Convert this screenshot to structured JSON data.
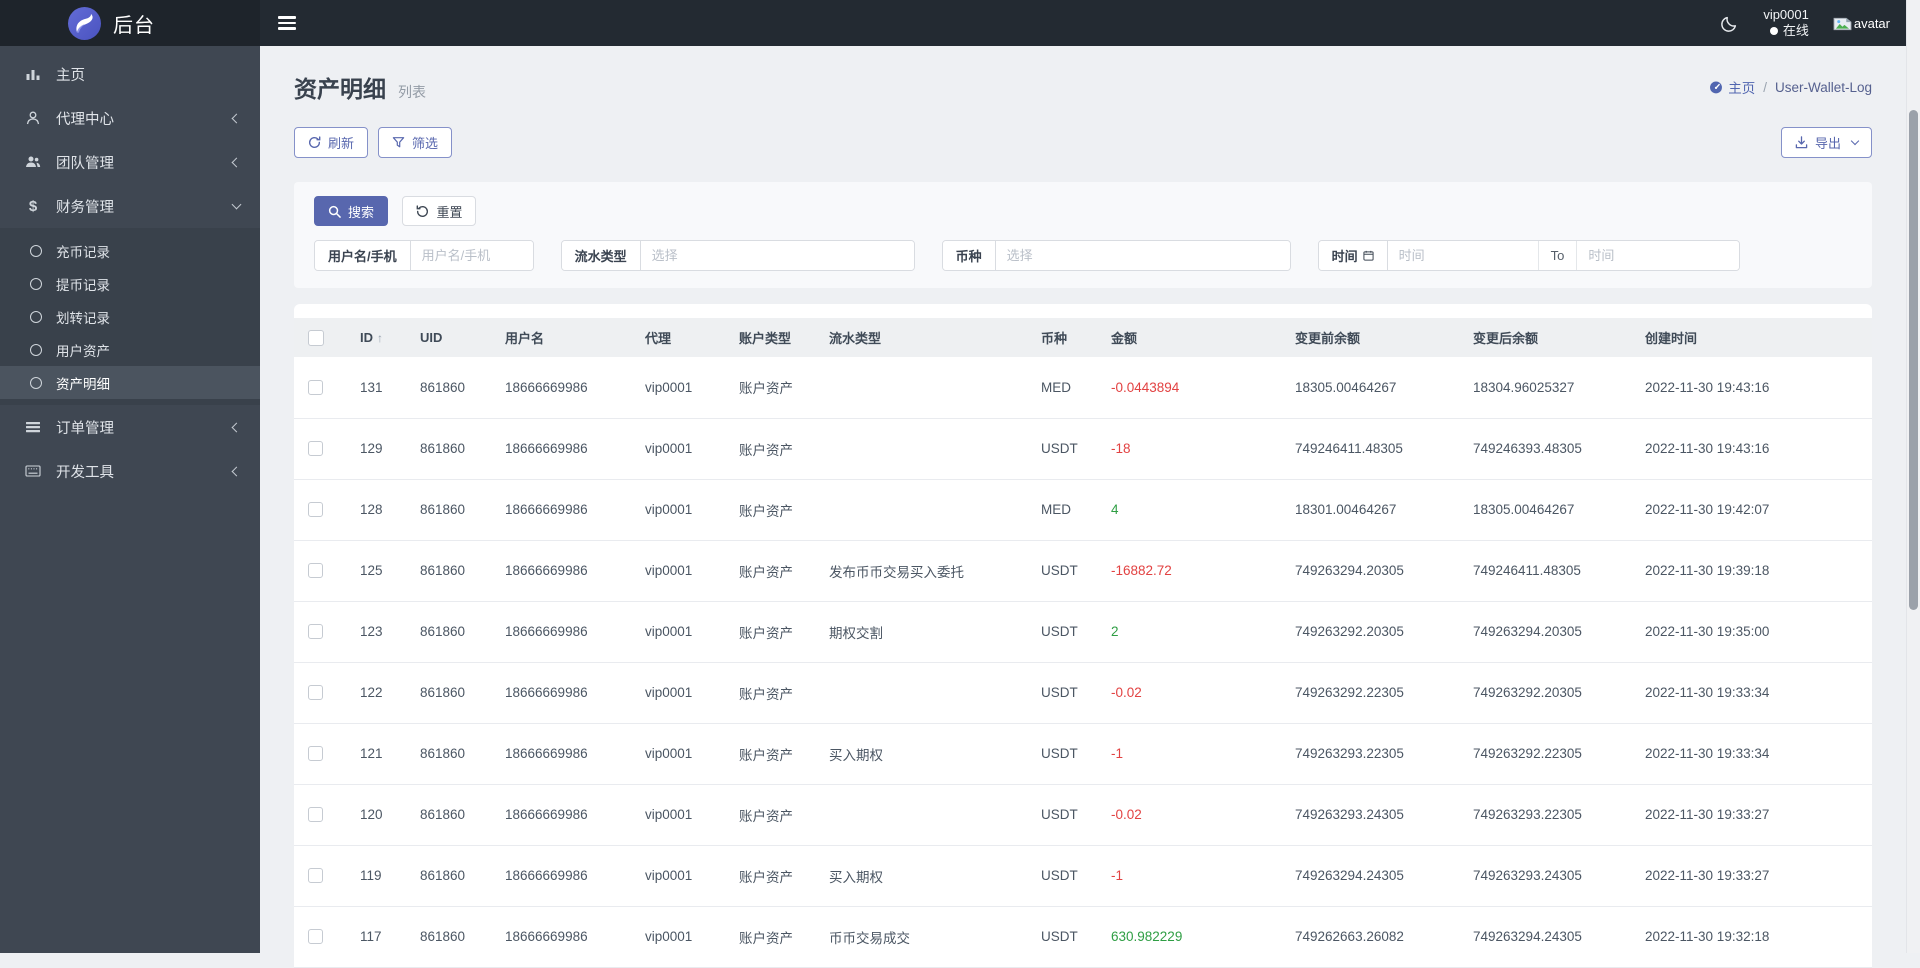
{
  "topbar": {
    "brand": "后台",
    "user": {
      "name": "vip0001",
      "status": "在线"
    },
    "avatar_alt": "avatar"
  },
  "sidebar": {
    "items": [
      {
        "label": "主页",
        "icon": "chart-bar-icon"
      },
      {
        "label": "代理中心",
        "icon": "agent-user-icon",
        "chevron": "left"
      },
      {
        "label": "团队管理",
        "icon": "team-users-icon",
        "chevron": "left"
      },
      {
        "label": "财务管理",
        "icon": "dollar-icon",
        "chevron": "down",
        "expanded": true,
        "children": [
          {
            "label": "充币记录"
          },
          {
            "label": "提币记录"
          },
          {
            "label": "划转记录"
          },
          {
            "label": "用户资产"
          },
          {
            "label": "资产明细",
            "active": true
          }
        ]
      },
      {
        "label": "订单管理",
        "icon": "list-icon",
        "chevron": "left"
      },
      {
        "label": "开发工具",
        "icon": "keyboard-icon",
        "chevron": "left"
      }
    ]
  },
  "page": {
    "title": "资产明细",
    "subtitle": "列表",
    "breadcrumb": {
      "home": "主页",
      "separator": "/",
      "current": "User-Wallet-Log"
    }
  },
  "toolbar": {
    "refresh_label": "刷新",
    "filter_label": "筛选",
    "export_label": "导出"
  },
  "filter_panel": {
    "search_label": "搜索",
    "reset_label": "重置",
    "fields": [
      {
        "name": "username-phone",
        "label": "用户名/手机",
        "placeholder": "用户名/手机",
        "type": "input",
        "input_width": 122
      },
      {
        "name": "flow-type",
        "label": "流水类型",
        "placeholder": "选择",
        "type": "select",
        "input_width": 273
      },
      {
        "name": "coin",
        "label": "币种",
        "placeholder": "选择",
        "type": "select",
        "input_width": 294
      },
      {
        "name": "time-range",
        "label": "时间",
        "type": "date-range",
        "placeholder": "时间",
        "to_label": "To",
        "placeholder2": "时间",
        "input_width": 150,
        "input_width2": 162
      }
    ]
  },
  "table": {
    "columns": [
      "ID",
      "UID",
      "用户名",
      "代理",
      "账户类型",
      "流水类型",
      "币种",
      "金额",
      "变更前余额",
      "变更后余额",
      "创建时间"
    ],
    "sort_column": "ID",
    "rows": [
      {
        "id": "131",
        "uid": "861860",
        "username": "18666669986",
        "agent": "vip0001",
        "account_type": "账户资产",
        "flow_type": "",
        "coin": "MED",
        "amount": "-0.0443894",
        "balance_before": "18305.00464267",
        "balance_after": "18304.96025327",
        "created_at": "2022-11-30 19:43:16"
      },
      {
        "id": "129",
        "uid": "861860",
        "username": "18666669986",
        "agent": "vip0001",
        "account_type": "账户资产",
        "flow_type": "",
        "coin": "USDT",
        "amount": "-18",
        "balance_before": "749246411.48305",
        "balance_after": "749246393.48305",
        "created_at": "2022-11-30 19:43:16"
      },
      {
        "id": "128",
        "uid": "861860",
        "username": "18666669986",
        "agent": "vip0001",
        "account_type": "账户资产",
        "flow_type": "",
        "coin": "MED",
        "amount": "4",
        "balance_before": "18301.00464267",
        "balance_after": "18305.00464267",
        "created_at": "2022-11-30 19:42:07"
      },
      {
        "id": "125",
        "uid": "861860",
        "username": "18666669986",
        "agent": "vip0001",
        "account_type": "账户资产",
        "flow_type": "发布币币交易买入委托",
        "coin": "USDT",
        "amount": "-16882.72",
        "balance_before": "749263294.20305",
        "balance_after": "749246411.48305",
        "created_at": "2022-11-30 19:39:18"
      },
      {
        "id": "123",
        "uid": "861860",
        "username": "18666669986",
        "agent": "vip0001",
        "account_type": "账户资产",
        "flow_type": "期权交割",
        "coin": "USDT",
        "amount": "2",
        "balance_before": "749263292.20305",
        "balance_after": "749263294.20305",
        "created_at": "2022-11-30 19:35:00"
      },
      {
        "id": "122",
        "uid": "861860",
        "username": "18666669986",
        "agent": "vip0001",
        "account_type": "账户资产",
        "flow_type": "",
        "coin": "USDT",
        "amount": "-0.02",
        "balance_before": "749263292.22305",
        "balance_after": "749263292.20305",
        "created_at": "2022-11-30 19:33:34"
      },
      {
        "id": "121",
        "uid": "861860",
        "username": "18666669986",
        "agent": "vip0001",
        "account_type": "账户资产",
        "flow_type": "买入期权",
        "coin": "USDT",
        "amount": "-1",
        "balance_before": "749263293.22305",
        "balance_after": "749263292.22305",
        "created_at": "2022-11-30 19:33:34"
      },
      {
        "id": "120",
        "uid": "861860",
        "username": "18666669986",
        "agent": "vip0001",
        "account_type": "账户资产",
        "flow_type": "",
        "coin": "USDT",
        "amount": "-0.02",
        "balance_before": "749263293.24305",
        "balance_after": "749263293.22305",
        "created_at": "2022-11-30 19:33:27"
      },
      {
        "id": "119",
        "uid": "861860",
        "username": "18666669986",
        "agent": "vip0001",
        "account_type": "账户资产",
        "flow_type": "买入期权",
        "coin": "USDT",
        "amount": "-1",
        "balance_before": "749263294.24305",
        "balance_after": "749263293.24305",
        "created_at": "2022-11-30 19:33:27"
      },
      {
        "id": "117",
        "uid": "861860",
        "username": "18666669986",
        "agent": "vip0001",
        "account_type": "账户资产",
        "flow_type": "币币交易成交",
        "coin": "USDT",
        "amount": "630.982229",
        "balance_before": "749262663.26082",
        "balance_after": "749263294.24305",
        "created_at": "2022-11-30 19:32:18"
      }
    ]
  },
  "colors": {
    "accent": "#5867ae",
    "amount_negative": "#e24242",
    "amount_positive": "#2f9e44",
    "sidebar_bg": "#3f4752",
    "topbar_bg": "#232a32"
  }
}
